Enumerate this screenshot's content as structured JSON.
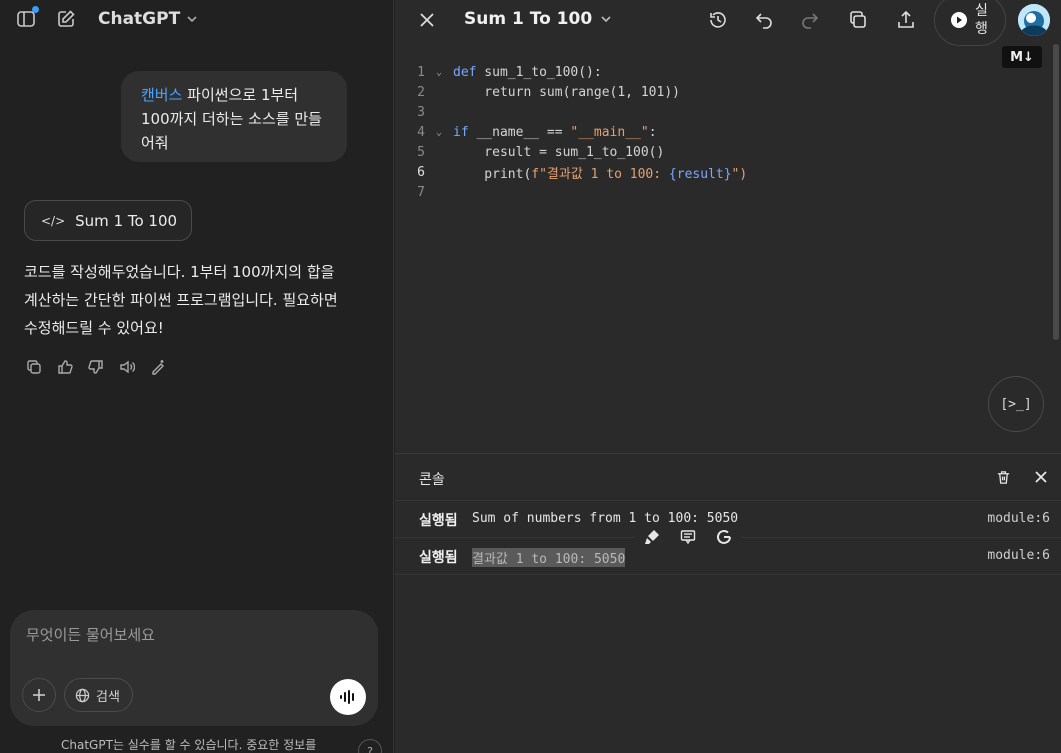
{
  "left": {
    "app_title": "ChatGPT",
    "user_message_hl": "캔버스",
    "user_message_rest": " 파이썬으로  1부터 100까지 더하는 소스를 만들어줘",
    "canvas_chip_label": "Sum 1 To 100",
    "assistant_reply": "코드를 작성해두었습니다. 1부터 100까지의 합을 계산하는 간단한 파이썬 프로그램입니다. 필요하면 수정해드릴 수 있어요!",
    "composer_placeholder": "무엇이든 물어보세요",
    "search_label": "검색",
    "disclaimer": "ChatGPT는 실수를 할 수 있습니다. 중요한 정보를",
    "help_label": "?",
    "colors": {
      "accent": "#3b9cff",
      "background": "#212121",
      "bubble": "#303030"
    }
  },
  "right": {
    "doc_title": "Sum 1 To 100",
    "run_label": "실행",
    "md_badge": "M↓",
    "terminal_label": "[>_]",
    "code": {
      "lines": [
        {
          "n": "1",
          "fold": true
        },
        {
          "n": "2",
          "fold": false
        },
        {
          "n": "3",
          "fold": false
        },
        {
          "n": "4",
          "fold": true
        },
        {
          "n": "5",
          "fold": false
        },
        {
          "n": "6",
          "fold": false,
          "current": true
        },
        {
          "n": "7",
          "fold": false
        }
      ],
      "l1_kw": "def",
      "l1_rest": " sum_1_to_100():",
      "l2": "    return sum(range(1, 101))",
      "l4_kw": "if",
      "l4_mid": " __name__ == ",
      "l4_str": "\"__main__\"",
      "l4_end": ":",
      "l5": "    result = sum_1_to_100()",
      "l6_a": "    print(",
      "l6_str": "f\"결과값 1 to 100: ",
      "l6_var": "{result}",
      "l6_end": "\")"
    },
    "console": {
      "title": "콘솔",
      "rows": [
        {
          "status": "실행됨",
          "message": "Sum of numbers from 1 to 100: 5050",
          "source": "module:6"
        },
        {
          "status": "실행됨",
          "message": "결과값 1 to 100: 5050",
          "source": "module:6"
        }
      ]
    }
  }
}
